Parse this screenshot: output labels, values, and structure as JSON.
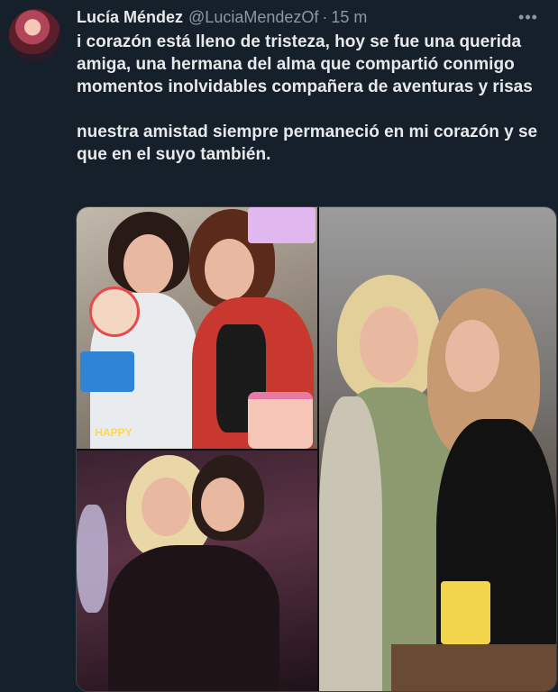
{
  "header": {
    "name": "Lucía Méndez",
    "handle": "@LuciaMendezOf",
    "dot": "·",
    "time": "15 m",
    "more_label": "•••"
  },
  "tweet": {
    "paragraph1": "i corazón está lleno de tristeza, hoy se fue una querida amiga, una hermana del alma que compartió conmigo momentos inolvidables compañera de aventuras y risas",
    "paragraph2": "nuestra amistad siempre permaneció en mi corazón y se que en el suyo también."
  },
  "media": {
    "sticker_text": "HAPPY"
  }
}
